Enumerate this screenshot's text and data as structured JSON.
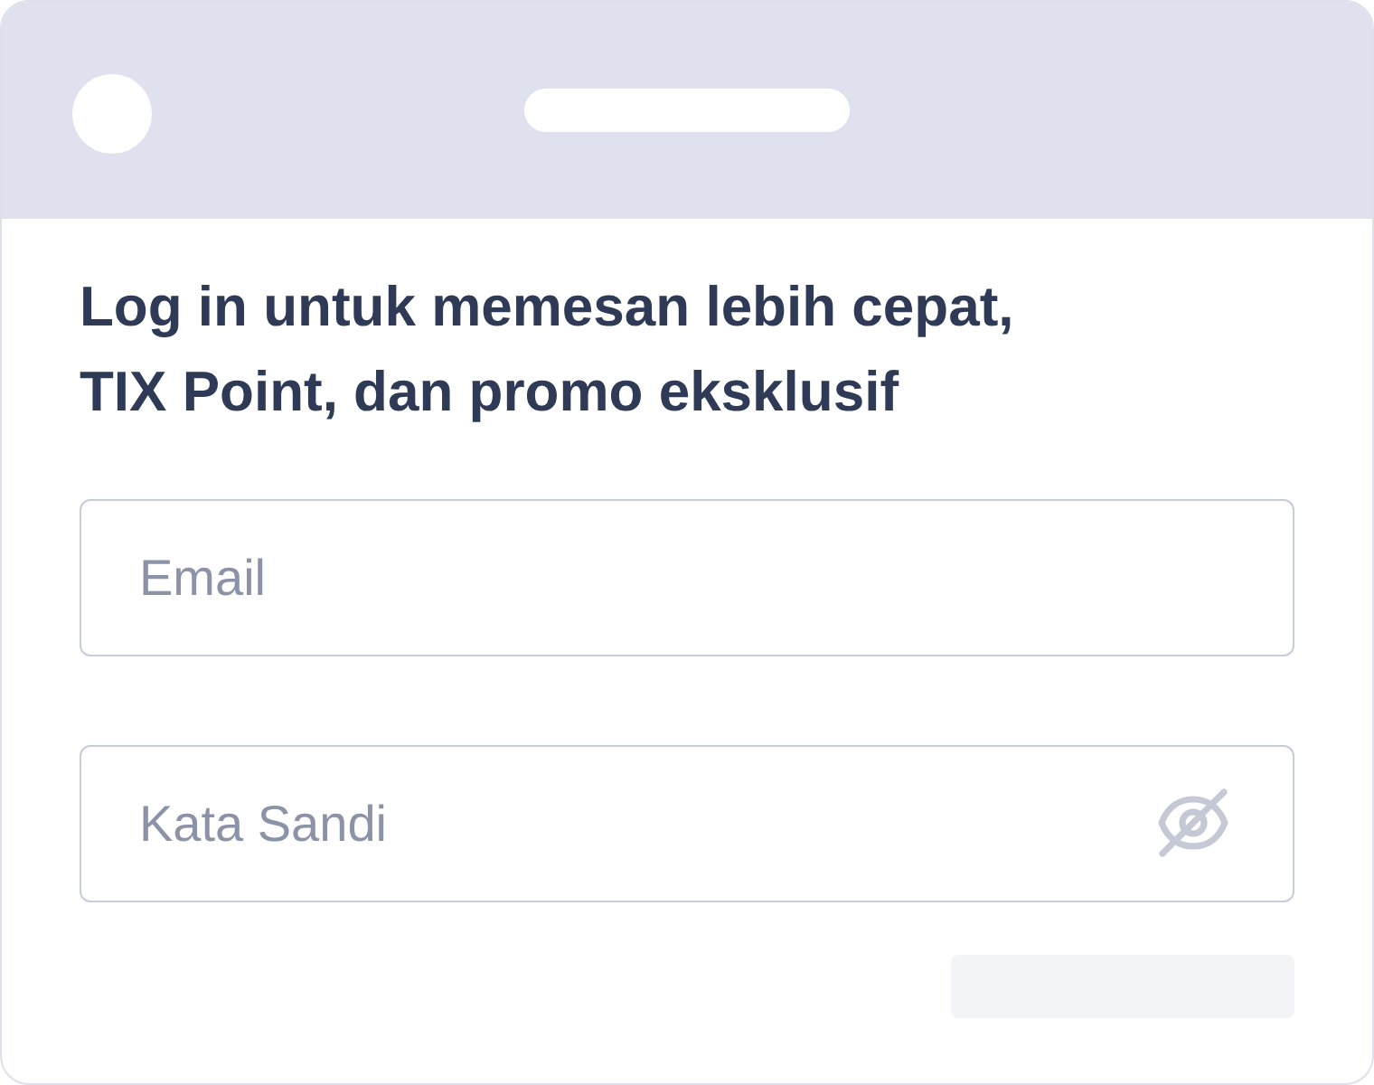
{
  "heading": "Log in untuk memesan lebih cepat, TIX Point, dan promo eksklusif",
  "fields": [
    {
      "kind": "email",
      "placeholder": "Email"
    },
    {
      "kind": "password",
      "placeholder": "Kata Sandi"
    }
  ]
}
